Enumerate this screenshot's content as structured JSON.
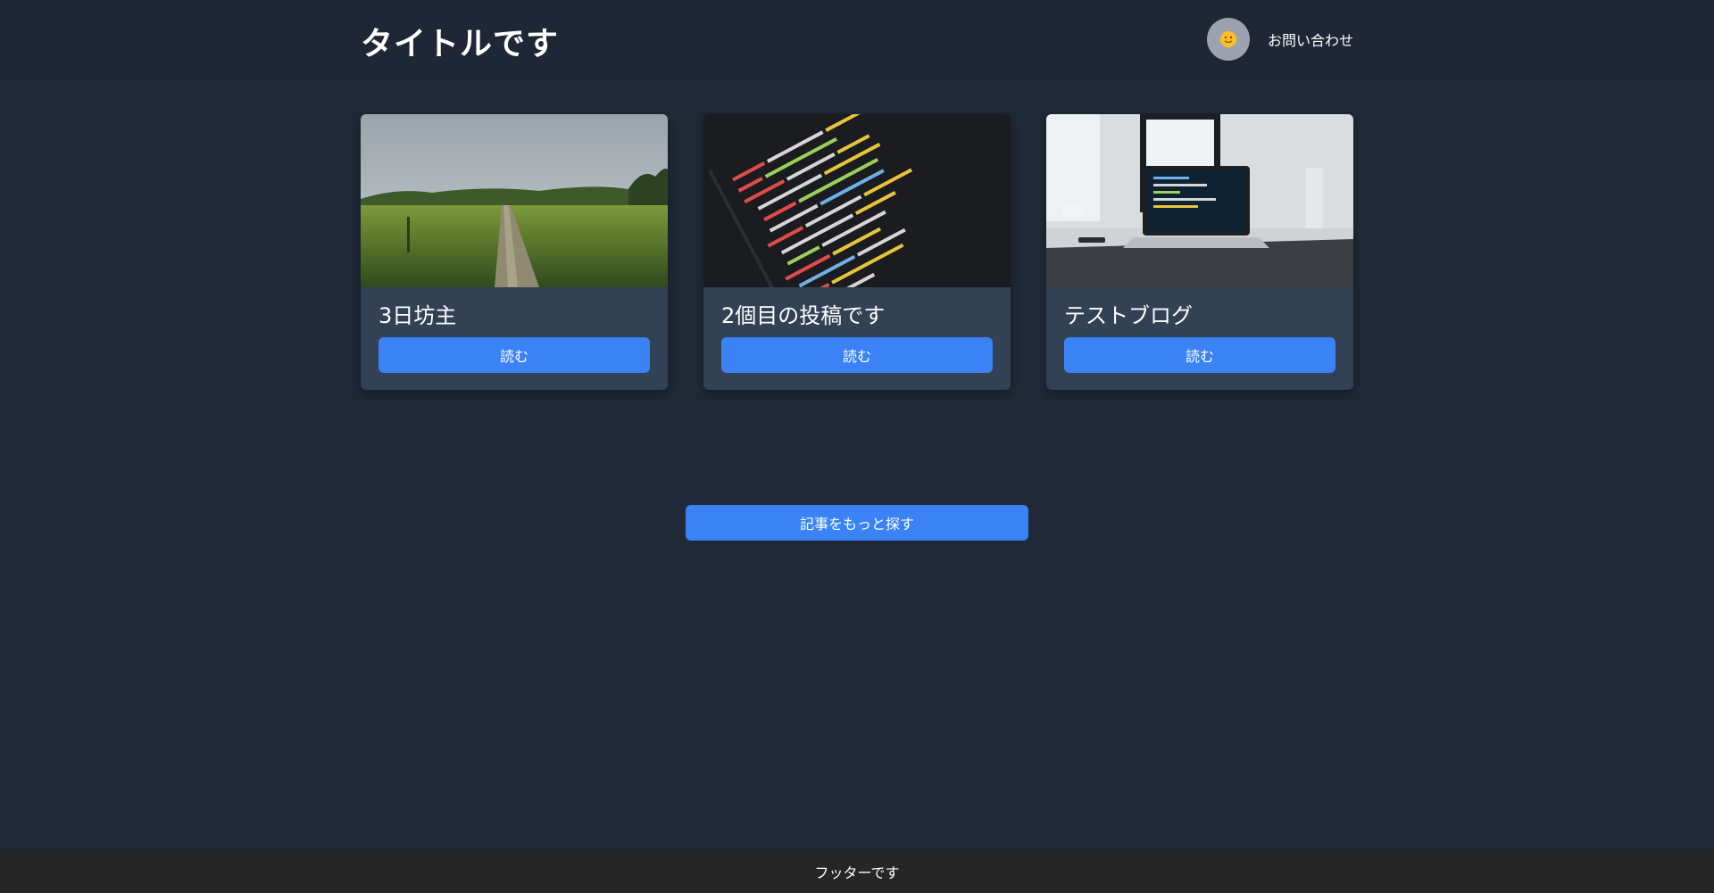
{
  "header": {
    "title": "タイトルです",
    "avatar_icon": "sun-face-icon",
    "contact_label": "お問い合わせ"
  },
  "posts": [
    {
      "title": "3日坊主",
      "button_label": "読む",
      "image": "rice-field-path-photo"
    },
    {
      "title": "2個目の投稿です",
      "button_label": "読む",
      "image": "code-on-screen-photo"
    },
    {
      "title": "テストブログ",
      "button_label": "読む",
      "image": "laptop-on-desk-photo"
    }
  ],
  "more_button_label": "記事をもっと探す",
  "footer": {
    "text": "フッターです"
  },
  "colors": {
    "background": "#1f2937",
    "card": "#334155",
    "accent": "#3b82f6",
    "footer": "#262626"
  }
}
